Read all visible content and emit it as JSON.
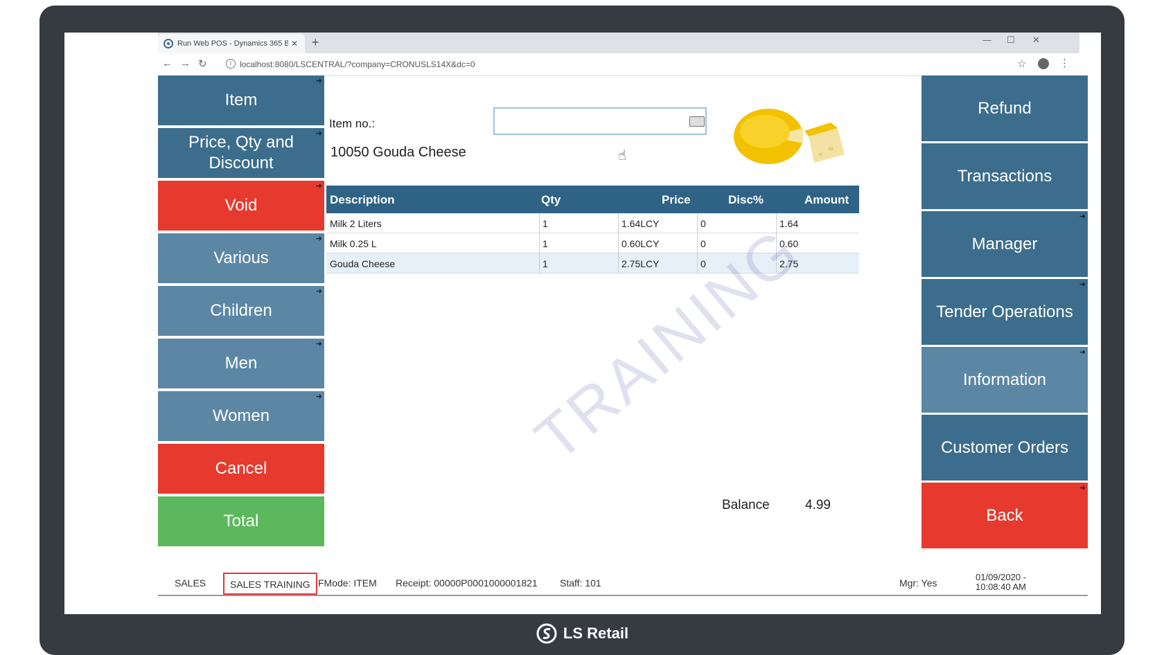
{
  "browser": {
    "tab_title": "Run Web POS - Dynamics 365 B",
    "url": "localhost:8080/LSCENTRAL/?company=CRONUSLS14X&dc=0"
  },
  "left_menu": [
    {
      "label": "Item",
      "style": "dark"
    },
    {
      "label": "Price, Qty and Discount",
      "style": "dark"
    },
    {
      "label": "Void",
      "style": "red"
    },
    {
      "label": "Various",
      "style": "mid"
    },
    {
      "label": "Children",
      "style": "mid"
    },
    {
      "label": "Men",
      "style": "mid"
    },
    {
      "label": "Women",
      "style": "mid"
    },
    {
      "label": "Cancel",
      "style": "red"
    },
    {
      "label": "Total",
      "style": "green"
    }
  ],
  "right_menu": [
    {
      "label": "Refund",
      "style": "dark"
    },
    {
      "label": "Transactions",
      "style": "dark"
    },
    {
      "label": "Manager",
      "style": "dark"
    },
    {
      "label": "Tender Operations",
      "style": "dark"
    },
    {
      "label": "Information",
      "style": "mid"
    },
    {
      "label": "Customer Orders",
      "style": "dark"
    },
    {
      "label": "Back",
      "style": "red"
    }
  ],
  "item": {
    "label": "Item no.:",
    "value": "",
    "description": "10050 Gouda Cheese"
  },
  "table": {
    "headers": [
      "Description",
      "Qty",
      "Price",
      "Disc%",
      "Amount"
    ],
    "rows": [
      {
        "description": "Milk 2 Liters",
        "qty": "1",
        "price": "1.64LCY",
        "disc": "0",
        "amount": "1.64"
      },
      {
        "description": "Milk 0.25 L",
        "qty": "1",
        "price": "0.60LCY",
        "disc": "0",
        "amount": "0.60"
      },
      {
        "description": "Gouda Cheese",
        "qty": "1",
        "price": "2.75LCY",
        "disc": "0",
        "amount": "2.75"
      }
    ]
  },
  "watermark": "TRAINING",
  "balance": {
    "label": "Balance",
    "value": "4.99"
  },
  "status": {
    "sales": "SALES",
    "sales_training": "SALES TRAINING",
    "fmode": "FMode: ITEM",
    "receipt": "Receipt: 00000P0001000001821",
    "staff": "Staff: 101",
    "mgr": "Mgr: Yes",
    "datetime": "01/09/2020 - 10:08:40 AM"
  },
  "brand": "LS Retail",
  "colors": {
    "dark_blue": "#3c6d8c",
    "mid_blue": "#5b87a4",
    "red": "#e63a2f",
    "green": "#5cb85c",
    "header": "#2f6386"
  }
}
